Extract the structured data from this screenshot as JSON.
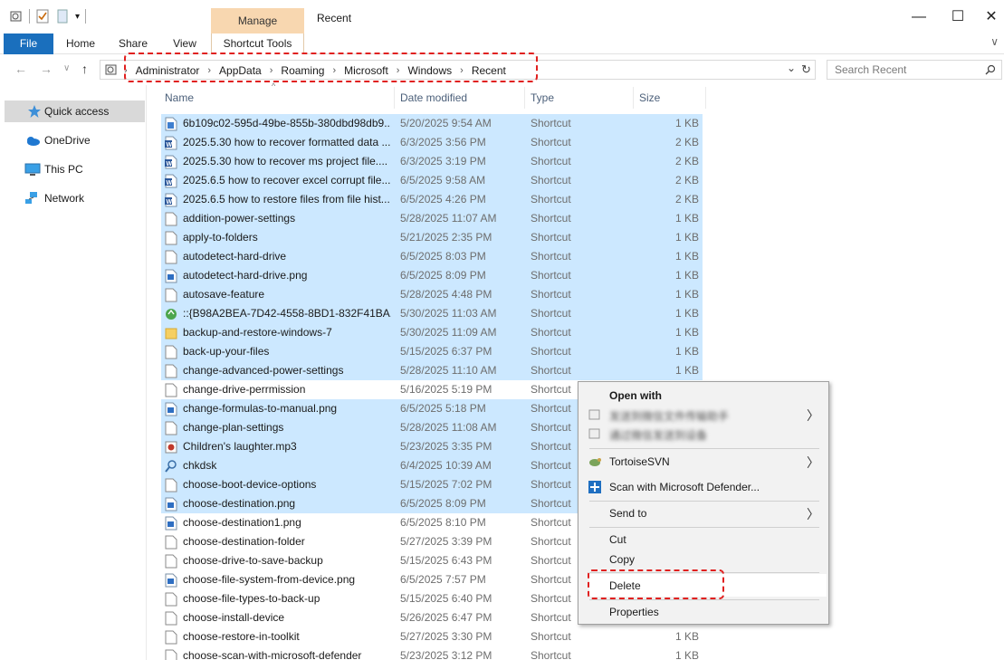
{
  "window": {
    "title": "Recent",
    "manage_label": "Manage",
    "min_glyph": "—",
    "max_glyph": "☐",
    "close_glyph": "✕"
  },
  "ribbon": {
    "tabs": [
      "File",
      "Home",
      "Share",
      "View",
      "Shortcut Tools"
    ],
    "collapse_glyph": "∨"
  },
  "address": {
    "crumbs": [
      "Administrator",
      "AppData",
      "Roaming",
      "Microsoft",
      "Windows",
      "Recent"
    ],
    "separator": "›",
    "search_placeholder": "Search Recent",
    "dropdown_glyph": "⌄",
    "refresh_glyph": "↻",
    "back_glyph": "←",
    "forward_glyph": "→",
    "dropdown_nav_glyph": "∨",
    "up_glyph": "↑"
  },
  "sidebar": {
    "items": [
      "Quick access",
      "OneDrive",
      "This PC",
      "Network"
    ]
  },
  "columns": {
    "name": "Name",
    "date": "Date modified",
    "type": "Type",
    "size": "Size",
    "sort_caret": "^"
  },
  "files": [
    {
      "name": "6b109c02-595d-49be-855b-380dbd98db9...",
      "date": "5/20/2025 9:54 AM",
      "type": "Shortcut",
      "size": "1 KB",
      "icon": "doc",
      "sel": true
    },
    {
      "name": "2025.5.30 how to recover formatted data ...",
      "date": "6/3/2025 3:56 PM",
      "type": "Shortcut",
      "size": "2 KB",
      "icon": "word",
      "sel": true
    },
    {
      "name": "2025.5.30 how to recover ms project file....",
      "date": "6/3/2025 3:19 PM",
      "type": "Shortcut",
      "size": "2 KB",
      "icon": "word",
      "sel": true
    },
    {
      "name": "2025.6.5 how to recover excel corrupt file...",
      "date": "6/5/2025 9:58 AM",
      "type": "Shortcut",
      "size": "2 KB",
      "icon": "word",
      "sel": true
    },
    {
      "name": "2025.6.5 how to restore files from file hist...",
      "date": "6/5/2025 4:26 PM",
      "type": "Shortcut",
      "size": "2 KB",
      "icon": "word",
      "sel": true
    },
    {
      "name": "addition-power-settings",
      "date": "5/28/2025 11:07 AM",
      "type": "Shortcut",
      "size": "1 KB",
      "icon": "blank",
      "sel": true
    },
    {
      "name": "apply-to-folders",
      "date": "5/21/2025 2:35 PM",
      "type": "Shortcut",
      "size": "1 KB",
      "icon": "blank",
      "sel": true
    },
    {
      "name": "autodetect-hard-drive",
      "date": "6/5/2025 8:03 PM",
      "type": "Shortcut",
      "size": "1 KB",
      "icon": "blank",
      "sel": true
    },
    {
      "name": "autodetect-hard-drive.png",
      "date": "6/5/2025 8:09 PM",
      "type": "Shortcut",
      "size": "1 KB",
      "icon": "img",
      "sel": true
    },
    {
      "name": "autosave-feature",
      "date": "5/28/2025 4:48 PM",
      "type": "Shortcut",
      "size": "1 KB",
      "icon": "blank",
      "sel": true
    },
    {
      "name": "::{B98A2BEA-7D42-4558-8BD1-832F41BA...",
      "date": "5/30/2025 11:03 AM",
      "type": "Shortcut",
      "size": "1 KB",
      "icon": "recycle",
      "sel": true
    },
    {
      "name": "backup-and-restore-windows-7",
      "date": "5/30/2025 11:09 AM",
      "type": "Shortcut",
      "size": "1 KB",
      "icon": "folder",
      "sel": true
    },
    {
      "name": "back-up-your-files",
      "date": "5/15/2025 6:37 PM",
      "type": "Shortcut",
      "size": "1 KB",
      "icon": "blank",
      "sel": true
    },
    {
      "name": "change-advanced-power-settings",
      "date": "5/28/2025 11:10 AM",
      "type": "Shortcut",
      "size": "1 KB",
      "icon": "blank",
      "sel": true
    },
    {
      "name": "change-drive-perrmission",
      "date": "5/16/2025 5:19 PM",
      "type": "Shortcut",
      "size": "",
      "icon": "blank",
      "sel": false
    },
    {
      "name": "change-formulas-to-manual.png",
      "date": "6/5/2025 5:18 PM",
      "type": "Shortcut",
      "size": "",
      "icon": "img",
      "sel": true
    },
    {
      "name": "change-plan-settings",
      "date": "5/28/2025 11:08 AM",
      "type": "Shortcut",
      "size": "",
      "icon": "blank",
      "sel": true
    },
    {
      "name": "Children's laughter.mp3",
      "date": "5/23/2025 3:35 PM",
      "type": "Shortcut",
      "size": "",
      "icon": "media",
      "sel": true
    },
    {
      "name": "chkdsk",
      "date": "6/4/2025 10:39 AM",
      "type": "Shortcut",
      "size": "",
      "icon": "search",
      "sel": true
    },
    {
      "name": "choose-boot-device-options",
      "date": "5/15/2025 7:02 PM",
      "type": "Shortcut",
      "size": "",
      "icon": "blank",
      "sel": true
    },
    {
      "name": "choose-destination.png",
      "date": "6/5/2025 8:09 PM",
      "type": "Shortcut",
      "size": "",
      "icon": "img",
      "sel": true
    },
    {
      "name": "choose-destination1.png",
      "date": "6/5/2025 8:10 PM",
      "type": "Shortcut",
      "size": "",
      "icon": "img",
      "sel": false
    },
    {
      "name": "choose-destination-folder",
      "date": "5/27/2025 3:39 PM",
      "type": "Shortcut",
      "size": "",
      "icon": "blank",
      "sel": false
    },
    {
      "name": "choose-drive-to-save-backup",
      "date": "5/15/2025 6:43 PM",
      "type": "Shortcut",
      "size": "",
      "icon": "blank",
      "sel": false
    },
    {
      "name": "choose-file-system-from-device.png",
      "date": "6/5/2025 7:57 PM",
      "type": "Shortcut",
      "size": "",
      "icon": "img",
      "sel": false
    },
    {
      "name": "choose-file-types-to-back-up",
      "date": "5/15/2025 6:40 PM",
      "type": "Shortcut",
      "size": "",
      "icon": "blank",
      "sel": false
    },
    {
      "name": "choose-install-device",
      "date": "5/26/2025 6:47 PM",
      "type": "Shortcut",
      "size": "",
      "icon": "blank",
      "sel": false
    },
    {
      "name": "choose-restore-in-toolkit",
      "date": "5/27/2025 3:30 PM",
      "type": "Shortcut",
      "size": "1 KB",
      "icon": "blank",
      "sel": false
    },
    {
      "name": "choose-scan-with-microsoft-defender",
      "date": "5/23/2025 3:12 PM",
      "type": "Shortcut",
      "size": "1 KB",
      "icon": "blank",
      "sel": false
    }
  ],
  "context_menu": {
    "open_with": "Open with",
    "blur1": "发送到微信文件传输助手",
    "blur2": "通过微信发送到设备",
    "tortoise": "TortoiseSVN",
    "defender": "Scan with Microsoft Defender...",
    "send_to": "Send to",
    "cut": "Cut",
    "copy": "Copy",
    "delete": "Delete",
    "properties": "Properties",
    "arrow_glyph": "〉"
  }
}
